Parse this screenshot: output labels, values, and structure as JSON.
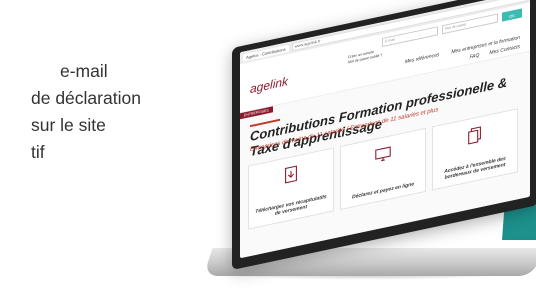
{
  "promo": {
    "line1": "e-mail",
    "line2": "de déclaration",
    "line3": "sur le site",
    "line4": "tif"
  },
  "browser": {
    "tab_label": "Agefos - Contributions",
    "url": "www.agelink.fr"
  },
  "site": {
    "logo": "agelink",
    "login": {
      "email_placeholder": "E-mail",
      "password_placeholder": "Mot de passe",
      "ok_label": "OK",
      "link1": "Créer un compte",
      "link2": "Mot de passe oublié ?"
    },
    "nav": {
      "item1": "Mes références",
      "item2": "Mes entreprises et la formation",
      "item3": "FAQ",
      "item4": "Mes Contacts"
    },
    "breadcrumb_tag": "ENTREPRISES",
    "hero": {
      "title": "Contributions Formation professionelle & Taxe d'apprentissage",
      "subtitle": "Entreprises de moins de 11 salariés / Entreprises de 11 salariés et plus"
    },
    "cards": [
      {
        "label": "Téléchargez vos récapitulatifs de versement",
        "icon": "download-document-icon"
      },
      {
        "label": "Déclarez et payez en ligne",
        "icon": "monitor-icon"
      },
      {
        "label": "Accédez à l'ensemble des bordereaux de versement",
        "icon": "documents-stack-icon"
      }
    ]
  },
  "colors": {
    "brand": "#8b1a2e",
    "accent": "#3cbdb4",
    "teal": "#2db3ad"
  }
}
